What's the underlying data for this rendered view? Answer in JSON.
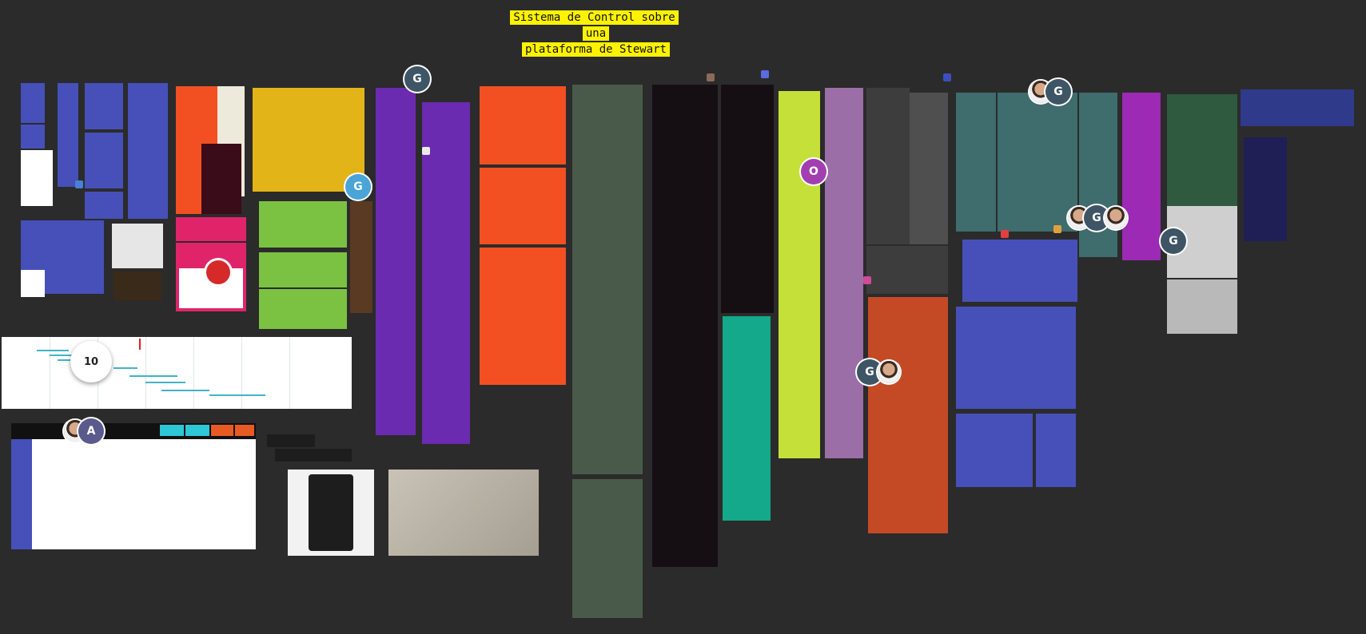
{
  "board": {
    "title_line1": "Sistema de Control sobre una",
    "title_line2": "plataforma de Stewart",
    "colors": {
      "background": "#2b2b2b",
      "title_highlight": "#fff200",
      "blue": "#4650b8",
      "orange": "#f25022",
      "yellow": "#e2b418",
      "green": "#7cc242",
      "purple": "#6a2bb0",
      "gray_green": "#4a5a4a",
      "black": "#150f14",
      "teal": "#13a98a",
      "lime": "#c6e03a",
      "mauve": "#9b6ea8",
      "slate": "#3f6c6c",
      "magenta": "#9c2ab4",
      "rust": "#c44a25",
      "navy": "#1f1f55"
    }
  },
  "collaborators": [
    {
      "initial": "G",
      "color": "#3e5566"
    },
    {
      "initial": "G",
      "color": "#4aa4d8"
    },
    {
      "initial": "O",
      "color": "#a23fb0"
    },
    {
      "initial": "G",
      "color": "#3e5566"
    },
    {
      "initial": "G",
      "color": "#3e5566"
    },
    {
      "initial": "G",
      "color": "#3e5566"
    },
    {
      "initial": "G",
      "color": "#3e5566"
    },
    {
      "initial": "A",
      "color": "#5b5a8c"
    }
  ],
  "counter": {
    "value": "10"
  }
}
